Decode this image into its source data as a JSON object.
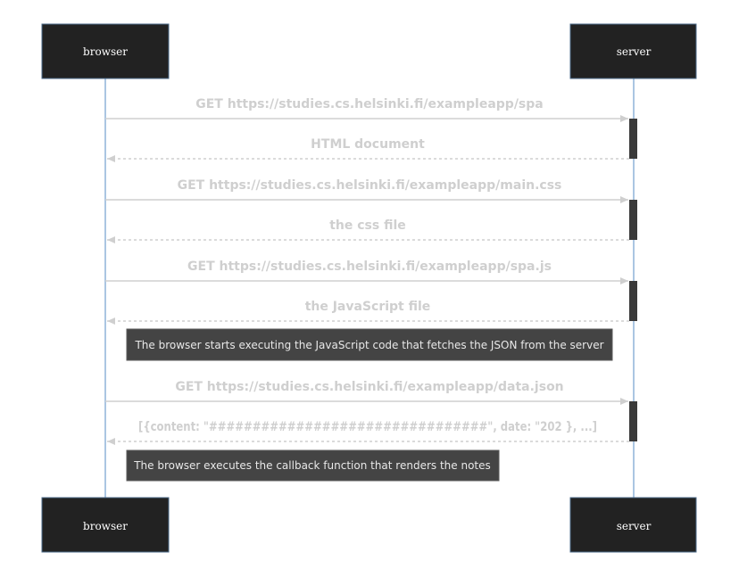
{
  "diagram": {
    "actors": [
      {
        "id": "browser",
        "label": "browser"
      },
      {
        "id": "server",
        "label": "server"
      }
    ],
    "steps": [
      {
        "kind": "message",
        "from": "browser",
        "to": "server",
        "style": "solid",
        "label": "GET https://studies.cs.helsinki.fi/exampleapp/spa"
      },
      {
        "kind": "message",
        "from": "server",
        "to": "browser",
        "style": "dashed",
        "label": "HTML document"
      },
      {
        "kind": "message",
        "from": "browser",
        "to": "server",
        "style": "solid",
        "label": "GET https://studies.cs.helsinki.fi/exampleapp/main.css"
      },
      {
        "kind": "message",
        "from": "server",
        "to": "browser",
        "style": "dashed",
        "label": "the css file"
      },
      {
        "kind": "message",
        "from": "browser",
        "to": "server",
        "style": "solid",
        "label": "GET https://studies.cs.helsinki.fi/exampleapp/spa.js"
      },
      {
        "kind": "message",
        "from": "server",
        "to": "browser",
        "style": "dashed",
        "label": "the JavaScript file"
      },
      {
        "kind": "note",
        "label": "The browser starts executing the JavaScript code that fetches the JSON from the server"
      },
      {
        "kind": "message",
        "from": "browser",
        "to": "server",
        "style": "solid",
        "label": "GET https://studies.cs.helsinki.fi/exampleapp/data.json"
      },
      {
        "kind": "message",
        "from": "server",
        "to": "browser",
        "style": "dashed",
        "label": "[{content: \"################################\", date: \"202 }, ...]"
      },
      {
        "kind": "note",
        "label": "The browser executes the callback function that renders the notes"
      }
    ]
  },
  "colors": {
    "actor_fill": "#222222",
    "lifeline": "#8fb4d8",
    "arrow": "#cfcfcf",
    "activation": "#3a3a3a",
    "note_fill": "#444444"
  }
}
